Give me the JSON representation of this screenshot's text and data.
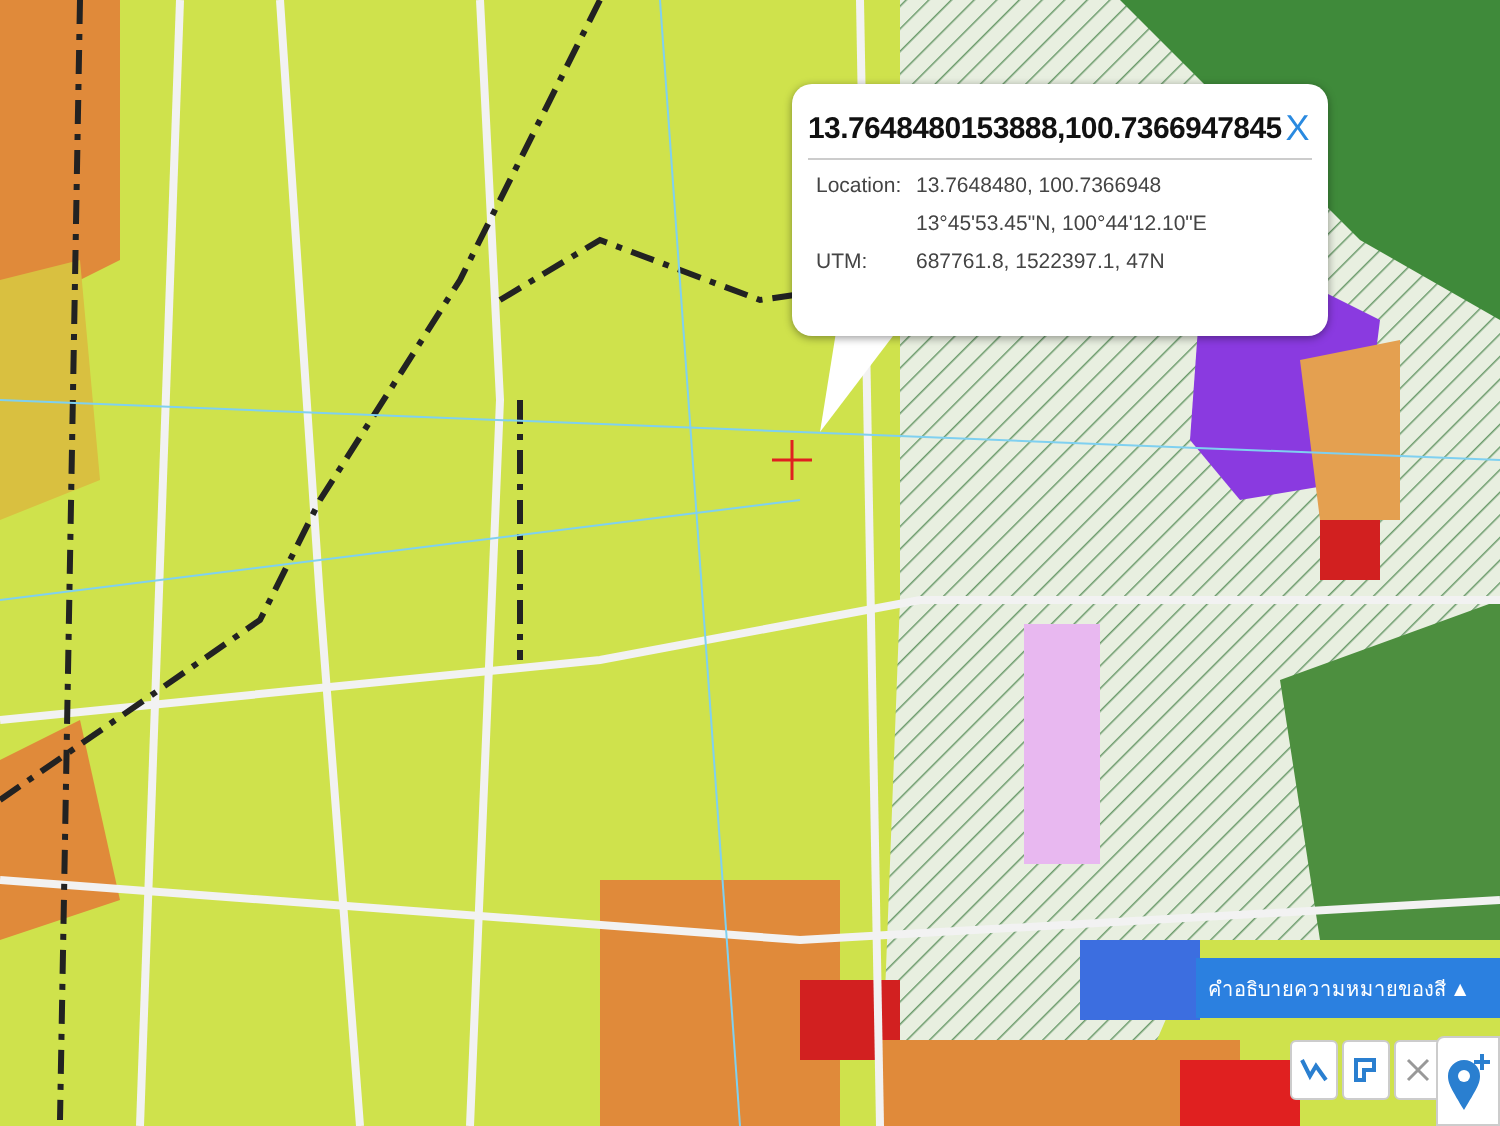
{
  "popup": {
    "title": "13.7648480153888,100.7366947845",
    "close": "X",
    "rows": [
      {
        "label": "Location:",
        "value": "13.7648480, 100.7366948"
      },
      {
        "value": "13°45'53.45\"N, 100°44'12.10\"E"
      },
      {
        "label": "UTM:",
        "value": "687761.8, 1522397.1, 47N"
      }
    ]
  },
  "legend_button": {
    "label": "คำอธิบายความหมายของสี",
    "arrow": "▲"
  }
}
